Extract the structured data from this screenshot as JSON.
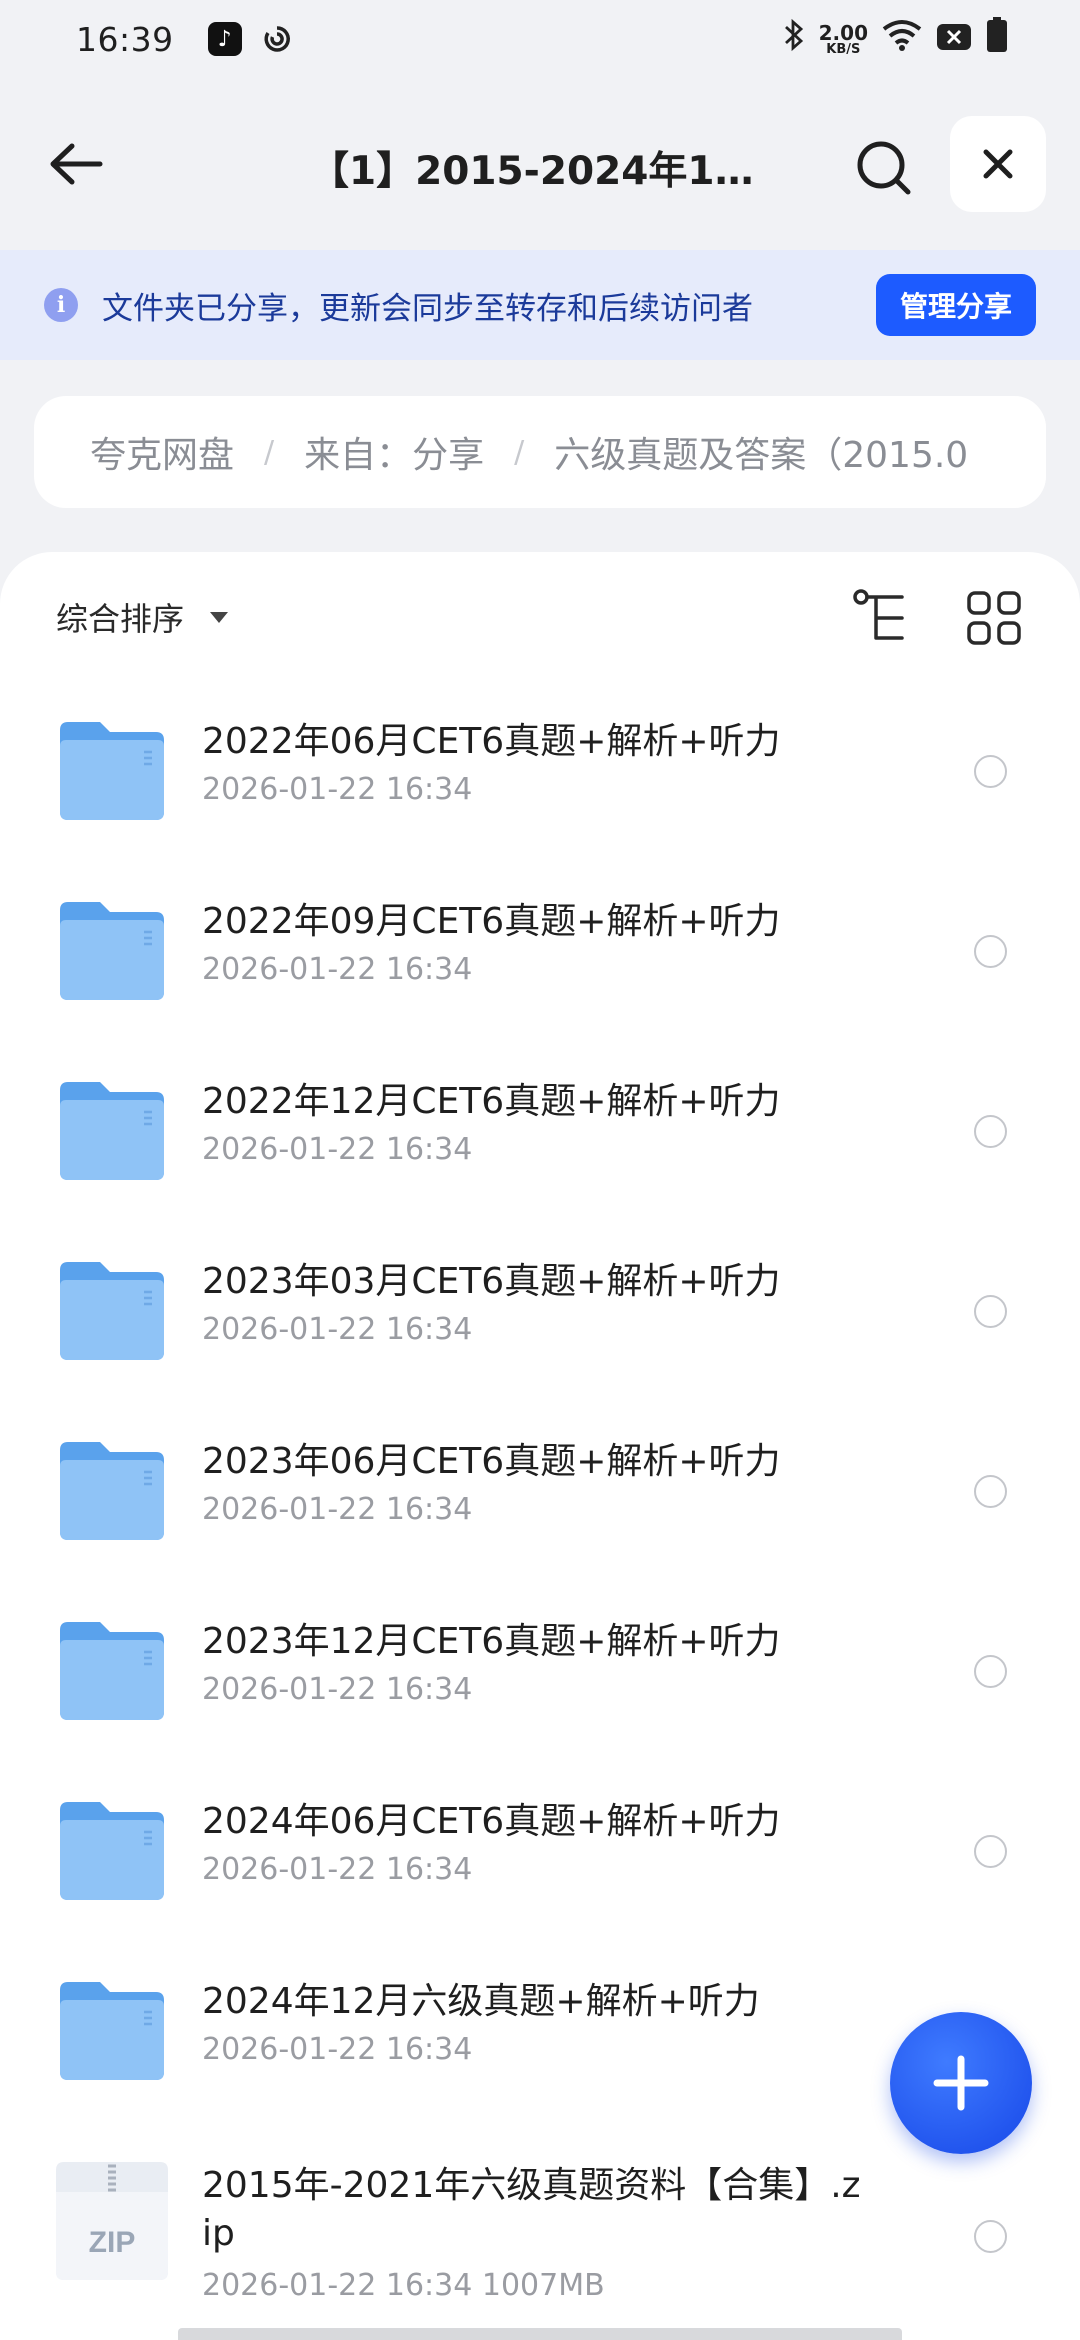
{
  "status_bar": {
    "time": "16:39",
    "net_speed_value": "2.00",
    "net_speed_unit": "KB/S",
    "icons": [
      "tiktok-app-icon",
      "sync-app-icon",
      "bluetooth-icon",
      "wifi-icon",
      "signal-off-icon",
      "battery-icon"
    ]
  },
  "header": {
    "title": "【1】2015-2024年12…",
    "back_icon": "arrow-left-icon",
    "search_icon": "search-icon",
    "close_icon": "close-icon"
  },
  "share_banner": {
    "text": "文件夹已分享，更新会同步至转存和后续访问者",
    "button_label": "管理分享",
    "colors": {
      "accent": "#1d5bff",
      "banner_bg": "#e6ebfb"
    }
  },
  "breadcrumb": {
    "items": [
      "夸克网盘",
      "来自：分享",
      "六级真题及答案（2015.0"
    ],
    "separator": "/"
  },
  "toolbar": {
    "sort_label": "综合排序"
  },
  "files": [
    {
      "name": "2022年06月CET6真题+解析+听力",
      "meta": "2026-01-22 16:34",
      "type": "folder"
    },
    {
      "name": "2022年09月CET6真题+解析+听力",
      "meta": "2026-01-22 16:34",
      "type": "folder"
    },
    {
      "name": "2022年12月CET6真题+解析+听力",
      "meta": "2026-01-22 16:34",
      "type": "folder"
    },
    {
      "name": "2023年03月CET6真题+解析+听力",
      "meta": "2026-01-22 16:34",
      "type": "folder"
    },
    {
      "name": "2023年06月CET6真题+解析+听力",
      "meta": "2026-01-22 16:34",
      "type": "folder"
    },
    {
      "name": "2023年12月CET6真题+解析+听力",
      "meta": "2026-01-22 16:34",
      "type": "folder"
    },
    {
      "name": "2024年06月CET6真题+解析+听力",
      "meta": "2026-01-22 16:34",
      "type": "folder"
    },
    {
      "name": "2024年12月六级真题+解析+听力",
      "meta": "2026-01-22 16:34",
      "type": "folder"
    },
    {
      "name": "2015年-2021年六级真题资料【合集】.zip",
      "meta": "2026-01-22 16:34  1007MB",
      "type": "zip",
      "icon_label": "ZIP"
    }
  ],
  "fab": {
    "icon": "plus-icon"
  }
}
